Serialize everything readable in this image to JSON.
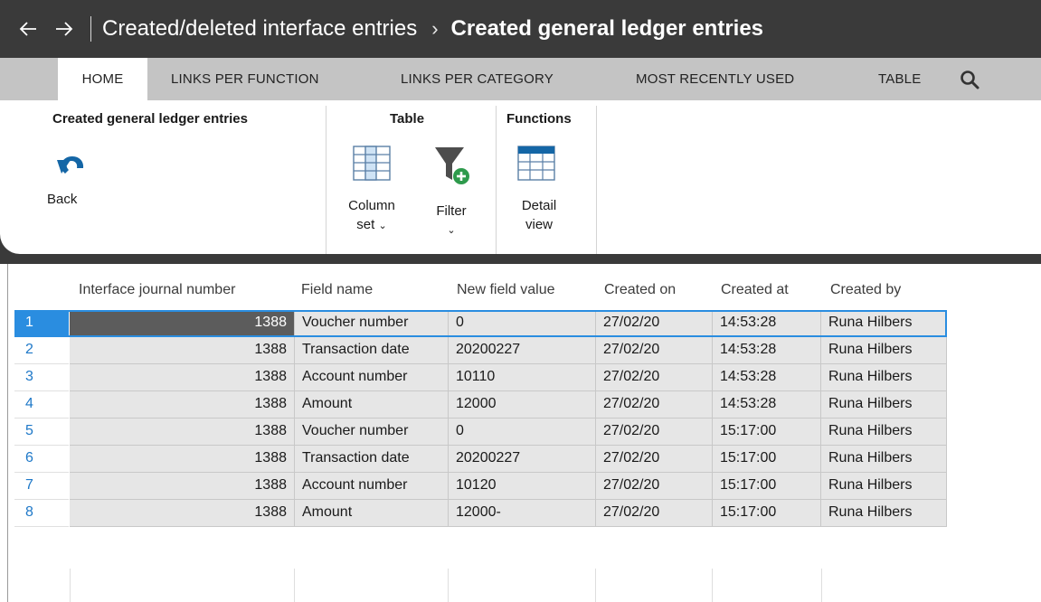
{
  "titlebar": {
    "back_label": "←",
    "forward_label": "→",
    "breadcrumb_parent": "Created/deleted interface entries",
    "breadcrumb_separator": "›",
    "page_title": "Created general ledger entries"
  },
  "tabs": [
    {
      "label": "HOME",
      "active": true
    },
    {
      "label": "LINKS PER FUNCTION",
      "active": false
    },
    {
      "label": "LINKS PER CATEGORY",
      "active": false
    },
    {
      "label": "MOST RECENTLY USED",
      "active": false
    },
    {
      "label": "TABLE",
      "active": false
    }
  ],
  "search_icon": "search-icon",
  "ribbon": {
    "groups": [
      {
        "title": "Created general ledger entries",
        "buttons": [
          {
            "label": "Back",
            "icon": "undo-arrow-icon"
          }
        ]
      },
      {
        "title": "Table",
        "buttons": [
          {
            "label_line1": "Column",
            "label_line2": "set",
            "icon": "column-set-icon",
            "dropdown": "⌄"
          },
          {
            "label_line1": "Filter",
            "label_line2": "",
            "icon": "filter-add-icon",
            "dropdown": "⌄"
          }
        ]
      },
      {
        "title": "Functions",
        "buttons": [
          {
            "label_line1": "Detail",
            "label_line2": "view",
            "icon": "detail-view-icon"
          }
        ]
      }
    ]
  },
  "grid": {
    "columns": [
      "Interface journal number",
      "Field name",
      "New field value",
      "Created on",
      "Created at",
      "Created by"
    ],
    "rows": [
      {
        "num": "1",
        "cells": [
          "1388",
          "Voucher number",
          "0",
          "27/02/20",
          "14:53:28",
          "Runa Hilbers"
        ],
        "selected": true
      },
      {
        "num": "2",
        "cells": [
          "1388",
          "Transaction date",
          "20200227",
          "27/02/20",
          "14:53:28",
          "Runa Hilbers"
        ]
      },
      {
        "num": "3",
        "cells": [
          "1388",
          "Account number",
          "10110",
          "27/02/20",
          "14:53:28",
          "Runa Hilbers"
        ]
      },
      {
        "num": "4",
        "cells": [
          "1388",
          "Amount",
          "12000",
          "27/02/20",
          "14:53:28",
          "Runa Hilbers"
        ]
      },
      {
        "num": "5",
        "cells": [
          "1388",
          "Voucher number",
          "0",
          "27/02/20",
          "15:17:00",
          "Runa Hilbers"
        ]
      },
      {
        "num": "6",
        "cells": [
          "1388",
          "Transaction date",
          "20200227",
          "27/02/20",
          "15:17:00",
          "Runa Hilbers"
        ]
      },
      {
        "num": "7",
        "cells": [
          "1388",
          "Account number",
          "10120",
          "27/02/20",
          "15:17:00",
          "Runa Hilbers"
        ]
      },
      {
        "num": "8",
        "cells": [
          "1388",
          "Amount",
          "12000-",
          "27/02/20",
          "15:17:00",
          "Runa Hilbers"
        ]
      }
    ]
  },
  "colors": {
    "titlebar_bg": "#3a3a3a",
    "tabstrip_bg": "#c4c4c4",
    "selection_blue": "#2a8de0",
    "row_number_blue": "#1e78c8",
    "cell_bg": "#e6e6e6",
    "icon_blue": "#1466a6",
    "icon_green": "#2e9a4c"
  }
}
